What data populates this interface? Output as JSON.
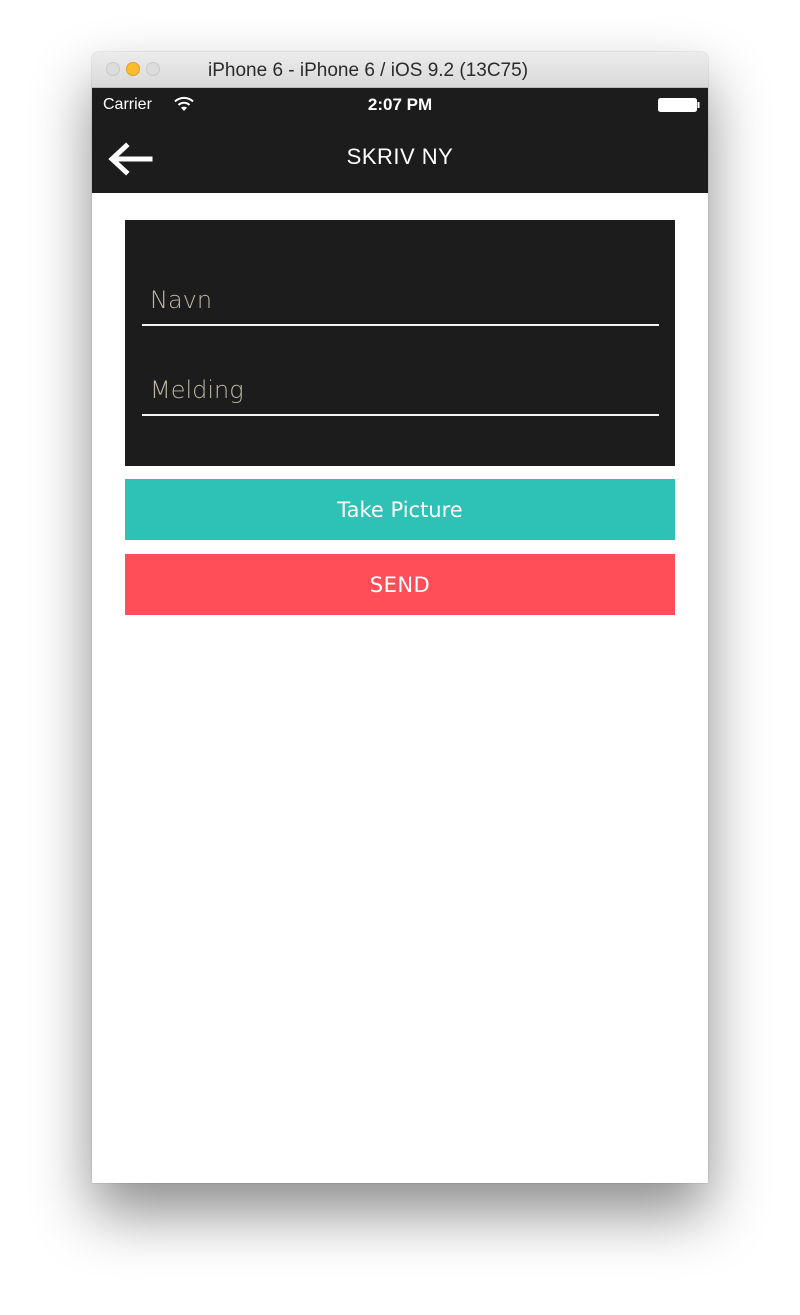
{
  "window": {
    "title": "iPhone 6 - iPhone 6 / iOS 9.2 (13C75)",
    "traffic_light_active_color": "#fdbc2e"
  },
  "statusbar": {
    "carrier": "Carrier",
    "time": "2:07 PM",
    "icons": [
      "wifi-icon",
      "battery-icon"
    ]
  },
  "navbar": {
    "title": "SKRIV NY",
    "back_icon": "back-arrow-icon"
  },
  "form": {
    "name_placeholder": "Navn",
    "name_value": "",
    "message_placeholder": "Melding",
    "message_value": ""
  },
  "buttons": {
    "take_picture": "Take Picture",
    "send": "SEND"
  },
  "colors": {
    "dark": "#1c1c1c",
    "teal": "#2ec1b5",
    "red": "#ff4e57",
    "placeholder": "#bdb8a8"
  }
}
